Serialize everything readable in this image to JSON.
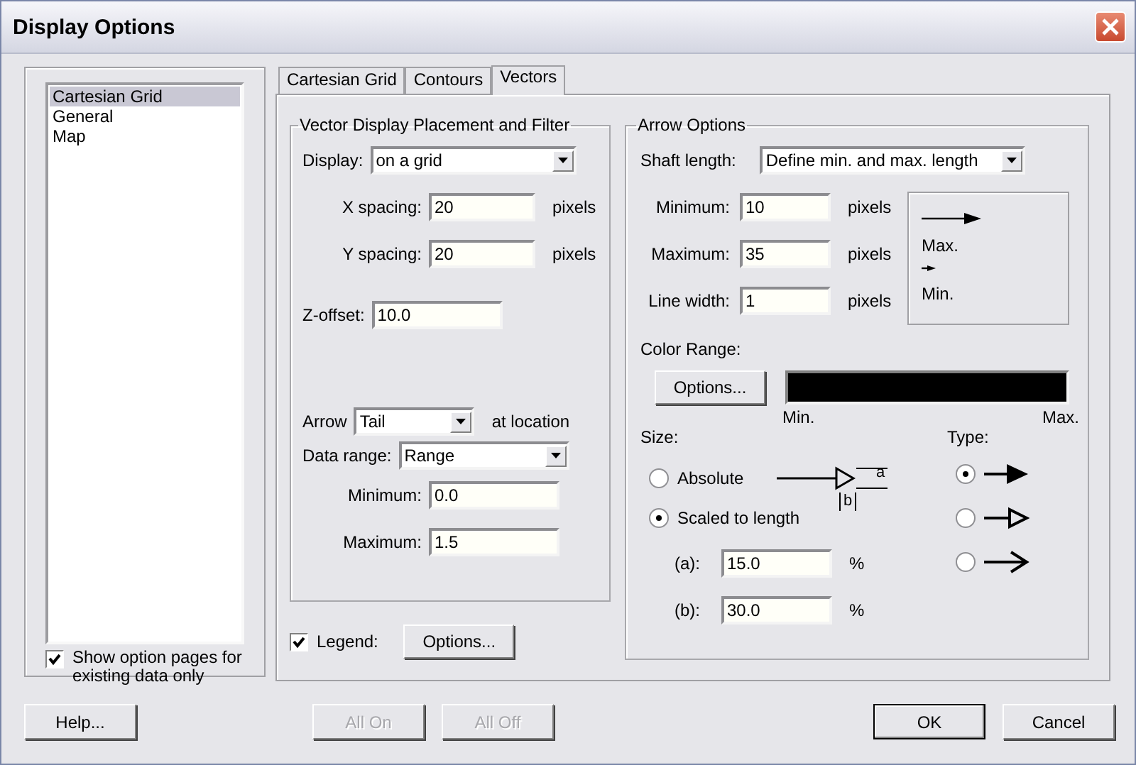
{
  "window": {
    "title": "Display Options"
  },
  "sidebar": {
    "items": [
      {
        "label": "Cartesian Grid",
        "selected": true
      },
      {
        "label": "General",
        "selected": false
      },
      {
        "label": "Map",
        "selected": false
      }
    ],
    "filter": {
      "label": "Show option pages for existing data only",
      "checked": true
    }
  },
  "tabs": [
    {
      "label": "Cartesian Grid",
      "selected": false
    },
    {
      "label": "Contours",
      "selected": false
    },
    {
      "label": "Vectors",
      "selected": true
    }
  ],
  "placement": {
    "title": "Vector Display Placement and Filter",
    "display": {
      "label": "Display:",
      "value": "on a grid"
    },
    "x_spacing": {
      "label": "X spacing:",
      "value": "20",
      "unit": "pixels"
    },
    "y_spacing": {
      "label": "Y spacing:",
      "value": "20",
      "unit": "pixels"
    },
    "z_offset": {
      "label": "Z-offset:",
      "value": "10.0"
    },
    "arrow": {
      "label": "Arrow",
      "value": "Tail",
      "suffix": "at location"
    },
    "data_range": {
      "label": "Data range:",
      "value": "Range"
    },
    "minimum": {
      "label": "Minimum:",
      "value": "0.0"
    },
    "maximum": {
      "label": "Maximum:",
      "value": "1.5"
    }
  },
  "legend": {
    "label": "Legend:",
    "checked": true,
    "button": "Options..."
  },
  "arrow_options": {
    "title": "Arrow Options",
    "shaft_length": {
      "label": "Shaft length:",
      "value": "Define min. and max. length"
    },
    "minimum": {
      "label": "Minimum:",
      "value": "10",
      "unit": "pixels"
    },
    "maximum": {
      "label": "Maximum:",
      "value": "35",
      "unit": "pixels"
    },
    "line_width": {
      "label": "Line width:",
      "value": "1",
      "unit": "pixels"
    },
    "preview": {
      "max_label": "Max.",
      "min_label": "Min."
    },
    "color_range": {
      "label": "Color Range:",
      "button": "Options...",
      "min_label": "Min.",
      "max_label": "Max."
    },
    "size": {
      "label": "Size:",
      "options": [
        {
          "label": "Absolute",
          "selected": false
        },
        {
          "label": "Scaled to length",
          "selected": true
        }
      ],
      "diagram": {
        "a": "a",
        "b": "b"
      },
      "a": {
        "label": "(a):",
        "value": "15.0",
        "unit": "%"
      },
      "b": {
        "label": "(b):",
        "value": "30.0",
        "unit": "%"
      }
    },
    "type": {
      "label": "Type:",
      "options": [
        {
          "kind": "filled",
          "selected": true
        },
        {
          "kind": "open",
          "selected": false
        },
        {
          "kind": "line",
          "selected": false
        }
      ]
    }
  },
  "buttons": [
    {
      "label": "Help...",
      "disabled": false
    },
    {
      "label": "All On",
      "disabled": true
    },
    {
      "label": "All Off",
      "disabled": true
    },
    {
      "label": "OK",
      "disabled": false
    },
    {
      "label": "Cancel",
      "disabled": false
    }
  ]
}
